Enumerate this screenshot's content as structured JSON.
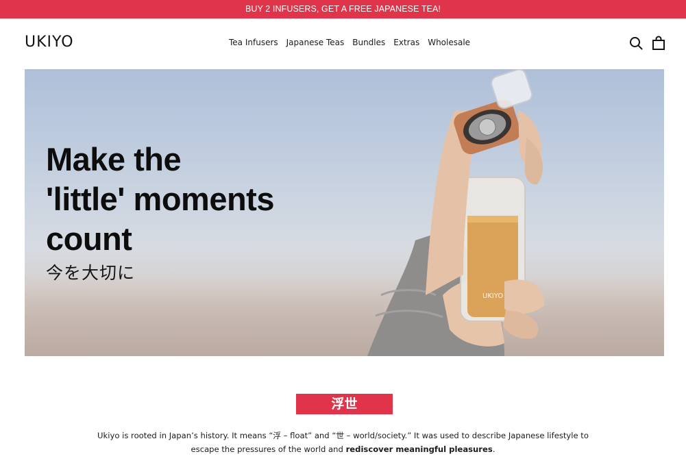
{
  "announcement": {
    "text": "BUY 2 INFUSERS, GET A FREE JAPANESE TEA!"
  },
  "header": {
    "logo": "UKIYO",
    "nav": [
      {
        "label": "Tea Infusers"
      },
      {
        "label": "Japanese Teas"
      },
      {
        "label": "Bundles"
      },
      {
        "label": "Extras"
      },
      {
        "label": "Wholesale"
      }
    ],
    "icons": [
      "search-icon",
      "cart-icon"
    ]
  },
  "hero": {
    "title_line1": "Make the",
    "title_line2": "'little' moments",
    "title_line3": "count",
    "subtitle": "今を大切に",
    "bottle_label": "UKIYO"
  },
  "about": {
    "badge": "浮世",
    "text_part1": "Ukiyo is rooted in Japan’s history. It means “浮 – float” and “世 – world/society.” It was used to describe Japanese lifestyle to escape the pressures of the world and ",
    "text_bold": "rediscover meaningful pleasures",
    "text_end": "."
  },
  "colors": {
    "accent": "#e0344a",
    "text": "#111111",
    "background": "#ffffff"
  }
}
